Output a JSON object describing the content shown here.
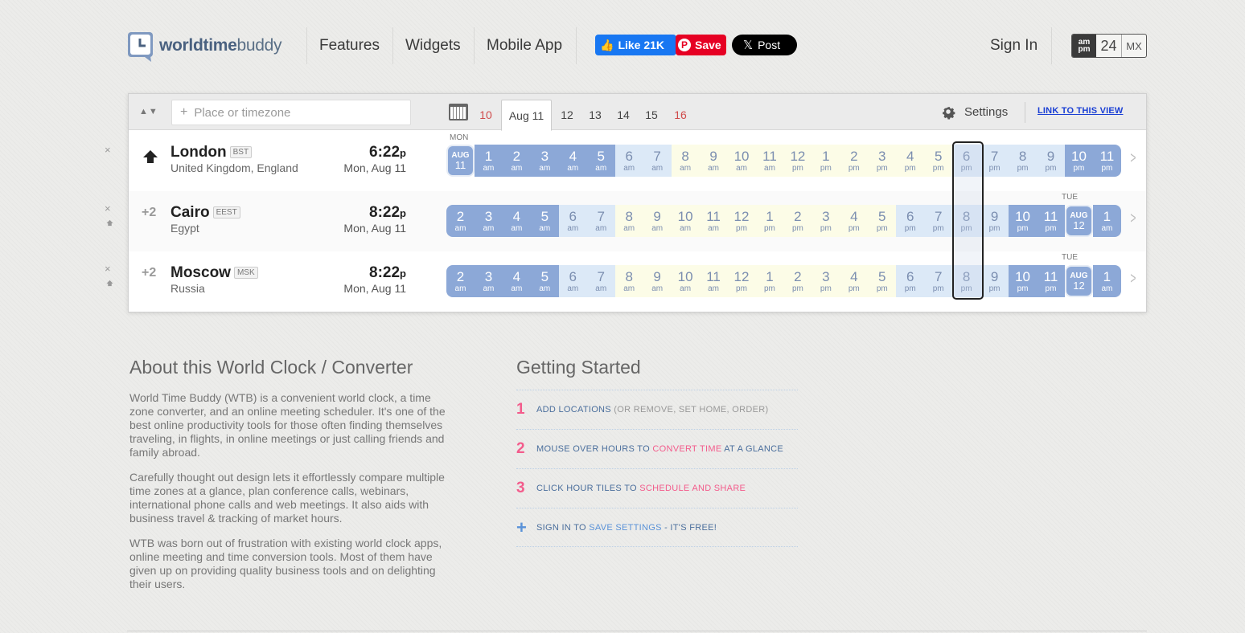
{
  "brand": {
    "logo_part1": "worldtime",
    "logo_part2": "buddy"
  },
  "nav": {
    "features": "Features",
    "widgets": "Widgets",
    "mobile_app": "Mobile App",
    "sign_in": "Sign In"
  },
  "social": {
    "like_label": "Like 21K",
    "save_label": "Save",
    "post_label": "Post"
  },
  "format": {
    "ampm_top": "am",
    "ampm_bottom": "pm",
    "h24": "24",
    "mx": "MX"
  },
  "toolbar": {
    "search_placeholder": "Place or timezone",
    "dates": [
      "10",
      "Aug 11",
      "12",
      "13",
      "14",
      "15",
      "16"
    ],
    "active_date": "Aug 11",
    "settings_label": "Settings",
    "link_label": "LINK TO THIS VIEW"
  },
  "rows": [
    {
      "offset": "",
      "city": "London",
      "abbr": "BST",
      "country": "United Kingdom, England",
      "time": "6:22",
      "suffix": "p",
      "date": "Mon, Aug 11",
      "top_label": "MON",
      "end_label": "",
      "hours": [
        {
          "h": "AUG",
          "m": "11",
          "type": "date"
        },
        {
          "h": "1",
          "m": "am",
          "type": "night"
        },
        {
          "h": "2",
          "m": "am",
          "type": "night"
        },
        {
          "h": "3",
          "m": "am",
          "type": "night"
        },
        {
          "h": "4",
          "m": "am",
          "type": "night"
        },
        {
          "h": "5",
          "m": "am",
          "type": "night"
        },
        {
          "h": "6",
          "m": "am",
          "type": "early"
        },
        {
          "h": "7",
          "m": "am",
          "type": "early"
        },
        {
          "h": "8",
          "m": "am",
          "type": "day"
        },
        {
          "h": "9",
          "m": "am",
          "type": "day"
        },
        {
          "h": "10",
          "m": "am",
          "type": "day"
        },
        {
          "h": "11",
          "m": "am",
          "type": "day"
        },
        {
          "h": "12",
          "m": "pm",
          "type": "day"
        },
        {
          "h": "1",
          "m": "pm",
          "type": "day"
        },
        {
          "h": "2",
          "m": "pm",
          "type": "day"
        },
        {
          "h": "3",
          "m": "pm",
          "type": "day"
        },
        {
          "h": "4",
          "m": "pm",
          "type": "day"
        },
        {
          "h": "5",
          "m": "pm",
          "type": "day"
        },
        {
          "h": "6",
          "m": "pm",
          "type": "early"
        },
        {
          "h": "7",
          "m": "pm",
          "type": "early"
        },
        {
          "h": "8",
          "m": "pm",
          "type": "early"
        },
        {
          "h": "9",
          "m": "pm",
          "type": "early"
        },
        {
          "h": "10",
          "m": "pm",
          "type": "night"
        },
        {
          "h": "11",
          "m": "pm",
          "type": "night"
        }
      ]
    },
    {
      "offset": "+2",
      "city": "Cairo",
      "abbr": "EEST",
      "country": "Egypt",
      "time": "8:22",
      "suffix": "p",
      "date": "Mon, Aug 11",
      "top_label": "",
      "end_label": "TUE",
      "hours": [
        {
          "h": "2",
          "m": "am",
          "type": "night"
        },
        {
          "h": "3",
          "m": "am",
          "type": "night"
        },
        {
          "h": "4",
          "m": "am",
          "type": "night"
        },
        {
          "h": "5",
          "m": "am",
          "type": "night"
        },
        {
          "h": "6",
          "m": "am",
          "type": "early"
        },
        {
          "h": "7",
          "m": "am",
          "type": "early"
        },
        {
          "h": "8",
          "m": "am",
          "type": "day"
        },
        {
          "h": "9",
          "m": "am",
          "type": "day"
        },
        {
          "h": "10",
          "m": "am",
          "type": "day"
        },
        {
          "h": "11",
          "m": "am",
          "type": "day"
        },
        {
          "h": "12",
          "m": "pm",
          "type": "day"
        },
        {
          "h": "1",
          "m": "pm",
          "type": "day"
        },
        {
          "h": "2",
          "m": "pm",
          "type": "day"
        },
        {
          "h": "3",
          "m": "pm",
          "type": "day"
        },
        {
          "h": "4",
          "m": "pm",
          "type": "day"
        },
        {
          "h": "5",
          "m": "pm",
          "type": "day"
        },
        {
          "h": "6",
          "m": "pm",
          "type": "early"
        },
        {
          "h": "7",
          "m": "pm",
          "type": "early"
        },
        {
          "h": "8",
          "m": "pm",
          "type": "early"
        },
        {
          "h": "9",
          "m": "pm",
          "type": "early"
        },
        {
          "h": "10",
          "m": "pm",
          "type": "night"
        },
        {
          "h": "11",
          "m": "pm",
          "type": "night"
        },
        {
          "h": "AUG",
          "m": "12",
          "type": "date"
        },
        {
          "h": "1",
          "m": "am",
          "type": "night"
        }
      ]
    },
    {
      "offset": "+2",
      "city": "Moscow",
      "abbr": "MSK",
      "country": "Russia",
      "time": "8:22",
      "suffix": "p",
      "date": "Mon, Aug 11",
      "top_label": "",
      "end_label": "TUE",
      "hours": [
        {
          "h": "2",
          "m": "am",
          "type": "night"
        },
        {
          "h": "3",
          "m": "am",
          "type": "night"
        },
        {
          "h": "4",
          "m": "am",
          "type": "night"
        },
        {
          "h": "5",
          "m": "am",
          "type": "night"
        },
        {
          "h": "6",
          "m": "am",
          "type": "early"
        },
        {
          "h": "7",
          "m": "am",
          "type": "early"
        },
        {
          "h": "8",
          "m": "am",
          "type": "day"
        },
        {
          "h": "9",
          "m": "am",
          "type": "day"
        },
        {
          "h": "10",
          "m": "am",
          "type": "day"
        },
        {
          "h": "11",
          "m": "am",
          "type": "day"
        },
        {
          "h": "12",
          "m": "pm",
          "type": "day"
        },
        {
          "h": "1",
          "m": "pm",
          "type": "day"
        },
        {
          "h": "2",
          "m": "pm",
          "type": "day"
        },
        {
          "h": "3",
          "m": "pm",
          "type": "day"
        },
        {
          "h": "4",
          "m": "pm",
          "type": "day"
        },
        {
          "h": "5",
          "m": "pm",
          "type": "day"
        },
        {
          "h": "6",
          "m": "pm",
          "type": "early"
        },
        {
          "h": "7",
          "m": "pm",
          "type": "early"
        },
        {
          "h": "8",
          "m": "pm",
          "type": "early"
        },
        {
          "h": "9",
          "m": "pm",
          "type": "early"
        },
        {
          "h": "10",
          "m": "pm",
          "type": "night"
        },
        {
          "h": "11",
          "m": "pm",
          "type": "night"
        },
        {
          "h": "AUG",
          "m": "12",
          "type": "date"
        },
        {
          "h": "1",
          "m": "am",
          "type": "night"
        }
      ]
    }
  ],
  "about": {
    "title": "About this World Clock / Converter",
    "p1": "World Time Buddy (WTB) is a convenient world clock, a time zone converter, and an online meeting scheduler. It's one of the best online productivity tools for those often finding themselves traveling, in flights, in online meetings or just calling friends and family abroad.",
    "p2": "Carefully thought out design lets it effortlessly compare multiple time zones at a glance, plan conference calls, webinars, international phone calls and web meetings. It also aids with business travel & tracking of market hours.",
    "p3": "WTB was born out of frustration with existing world clock apps, online meeting and time conversion tools. Most of them have given up on providing quality business tools and on delighting their users."
  },
  "getting_started": {
    "title": "Getting Started",
    "steps": [
      {
        "num": "1",
        "a": "ADD LOCATIONS ",
        "b": "(OR REMOVE, SET HOME, ORDER)",
        "c": ""
      },
      {
        "num": "2",
        "a": "MOUSE OVER HOURS TO ",
        "b": "CONVERT TIME",
        "c": " AT A GLANCE"
      },
      {
        "num": "3",
        "a": "CLICK HOUR TILES TO ",
        "b": "SCHEDULE AND SHARE",
        "c": ""
      },
      {
        "num": "+",
        "a": "SIGN IN TO ",
        "b": "SAVE SETTINGS",
        "c": " - IT'S FREE!"
      }
    ]
  },
  "colors": {
    "night": "#8ca8d7",
    "early": "#dce9f7",
    "day": "#fcfce7",
    "accent_pink": "#f35c8c",
    "link_blue": "#1a3fd4"
  }
}
